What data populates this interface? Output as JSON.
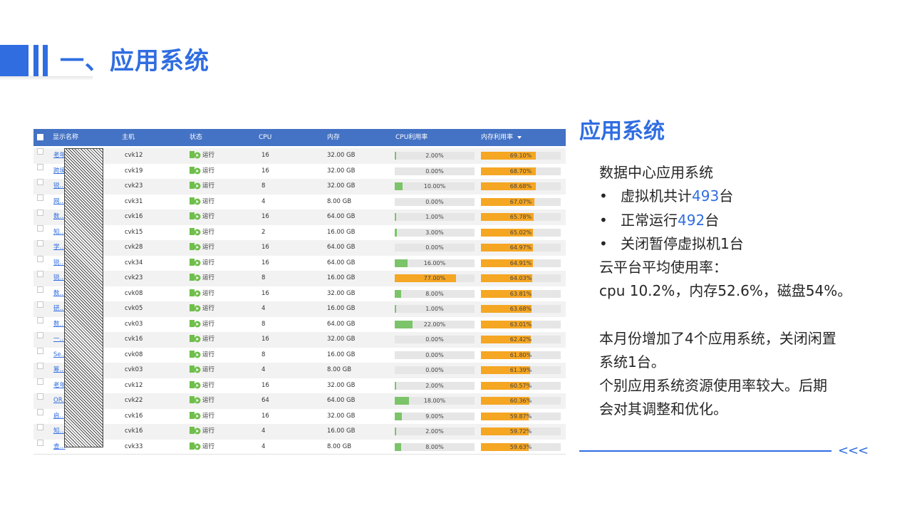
{
  "page_title": "一、应用系统",
  "table": {
    "headers": [
      "显示名称",
      "主机",
      "状态",
      "CPU",
      "内存",
      "CPU利用率",
      "内存利用率"
    ],
    "rows": [
      {
        "name": "老年...",
        "host": "cvk12",
        "status": "运行",
        "cpu": "16",
        "mem": "32.00 GB",
        "cpu_util": 2.0,
        "cpu_util_text": "2.00%",
        "mem_util": 69.1,
        "mem_util_text": "69.10%"
      },
      {
        "name": "跨境...条",
        "host": "cvk19",
        "status": "运行",
        "cpu": "16",
        "mem": "32.00 GB",
        "cpu_util": 0.0,
        "cpu_util_text": "0.00%",
        "mem_util": 68.7,
        "mem_util_text": "68.70%"
      },
      {
        "name": "锐...",
        "host": "cvk23",
        "status": "运行",
        "cpu": "8",
        "mem": "32.00 GB",
        "cpu_util": 10.0,
        "cpu_util_text": "10.00%",
        "mem_util": 68.68,
        "mem_util_text": "68.68%"
      },
      {
        "name": "网...器",
        "host": "cvk31",
        "status": "运行",
        "cpu": "4",
        "mem": "8.00 GB",
        "cpu_util": 0.0,
        "cpu_util_text": "0.00%",
        "mem_util": 67.07,
        "mem_util_text": "67.07%"
      },
      {
        "name": "数...金",
        "host": "cvk16",
        "status": "运行",
        "cpu": "16",
        "mem": "64.00 GB",
        "cpu_util": 1.0,
        "cpu_util_text": "1.00%",
        "mem_util": 65.78,
        "mem_util_text": "65.78%"
      },
      {
        "name": "知...平台",
        "host": "cvk15",
        "status": "运行",
        "cpu": "2",
        "mem": "16.00 GB",
        "cpu_util": 3.0,
        "cpu_util_text": "3.00%",
        "mem_util": 65.02,
        "mem_util_text": "65.02%"
      },
      {
        "name": "学...1",
        "host": "cvk28",
        "status": "运行",
        "cpu": "16",
        "mem": "64.00 GB",
        "cpu_util": 0.0,
        "cpu_util_text": "0.00%",
        "mem_util": 64.97,
        "mem_util_text": "64.97%"
      },
      {
        "name": "锐...001",
        "host": "cvk34",
        "status": "运行",
        "cpu": "16",
        "mem": "64.00 GB",
        "cpu_util": 16.0,
        "cpu_util_text": "16.00%",
        "mem_util": 64.91,
        "mem_util_text": "64.91%"
      },
      {
        "name": "锐...",
        "host": "cvk23",
        "status": "运行",
        "cpu": "8",
        "mem": "16.00 GB",
        "cpu_util": 77.0,
        "cpu_util_text": "77.00%",
        "mem_util": 64.03,
        "mem_util_text": "64.03%"
      },
      {
        "name": "数...务",
        "host": "cvk08",
        "status": "运行",
        "cpu": "16",
        "mem": "32.00 GB",
        "cpu_util": 8.0,
        "cpu_util_text": "8.00%",
        "mem_util": 63.81,
        "mem_util_text": "63.81%"
      },
      {
        "name": "研...应用",
        "host": "cvk05",
        "status": "运行",
        "cpu": "4",
        "mem": "16.00 GB",
        "cpu_util": 1.0,
        "cpu_util_text": "1.00%",
        "mem_util": 63.68,
        "mem_util_text": "63.68%"
      },
      {
        "name": "数...",
        "host": "cvk03",
        "status": "运行",
        "cpu": "8",
        "mem": "64.00 GB",
        "cpu_util": 22.0,
        "cpu_util_text": "22.00%",
        "mem_util": 63.01,
        "mem_util_text": "63.01%"
      },
      {
        "name": "一...统",
        "host": "cvk16",
        "status": "运行",
        "cpu": "16",
        "mem": "32.00 GB",
        "cpu_util": 0.0,
        "cpu_util_text": "0.00%",
        "mem_util": 62.42,
        "mem_util_text": "62.42%"
      },
      {
        "name": "Se...2",
        "host": "cvk08",
        "status": "运行",
        "cpu": "8",
        "mem": "16.00 GB",
        "cpu_util": 0.0,
        "cpu_util_text": "0.00%",
        "mem_util": 61.8,
        "mem_util_text": "61.80%"
      },
      {
        "name": "筹...开发",
        "host": "cvk03",
        "status": "运行",
        "cpu": "4",
        "mem": "8.00 GB",
        "cpu_util": 0.0,
        "cpu_util_text": "0.00%",
        "mem_util": 61.39,
        "mem_util_text": "61.39%"
      },
      {
        "name": "老年...",
        "host": "cvk12",
        "status": "运行",
        "cpu": "16",
        "mem": "32.00 GB",
        "cpu_util": 2.0,
        "cpu_util_text": "2.00%",
        "mem_util": 60.57,
        "mem_util_text": "60.57%"
      },
      {
        "name": "OR...",
        "host": "cvk22",
        "status": "运行",
        "cpu": "64",
        "mem": "64.00 GB",
        "cpu_util": 18.0,
        "cpu_util_text": "18.00%",
        "mem_util": 60.36,
        "mem_util_text": "60.36%"
      },
      {
        "name": "启...",
        "host": "cvk16",
        "status": "运行",
        "cpu": "16",
        "mem": "32.00 GB",
        "cpu_util": 9.0,
        "cpu_util_text": "9.00%",
        "mem_util": 59.87,
        "mem_util_text": "59.87%"
      },
      {
        "name": "知...务",
        "host": "cvk16",
        "status": "运行",
        "cpu": "4",
        "mem": "16.00 GB",
        "cpu_util": 2.0,
        "cpu_util_text": "2.00%",
        "mem_util": 59.72,
        "mem_util_text": "59.72%"
      },
      {
        "name": "查...",
        "host": "cvk33",
        "status": "运行",
        "cpu": "4",
        "mem": "8.00 GB",
        "cpu_util": 8.0,
        "cpu_util_text": "8.00%",
        "mem_util": 59.63,
        "mem_util_text": "59.63%"
      }
    ]
  },
  "side": {
    "title": "应用系统",
    "intro": "数据中心应用系统",
    "bullets": [
      {
        "pre": "虚拟机共计",
        "hl": "493",
        "post": "台"
      },
      {
        "pre": "正常运行",
        "hl": "492",
        "post": "台"
      },
      {
        "pre": "关闭暂停虚拟机1台",
        "hl": "",
        "post": ""
      }
    ],
    "avg_label": "云平台平均使用率：",
    "avg_values": "cpu 10.2%，内存52.6%，磁盘54%。",
    "para1_line1": "本月份增加了4个应用系统，关闭闲置",
    "para1_line2": "系统1台。",
    "para2_line1": "个别应用系统资源使用率较大。后期",
    "para2_line2": "会对其调整和优化。",
    "chevrons": "<<<"
  },
  "colors": {
    "accent": "#2f6de1",
    "table_header": "#4472c4",
    "cpu_bar": "#7cc46a",
    "mem_bar": "#f5a623"
  }
}
